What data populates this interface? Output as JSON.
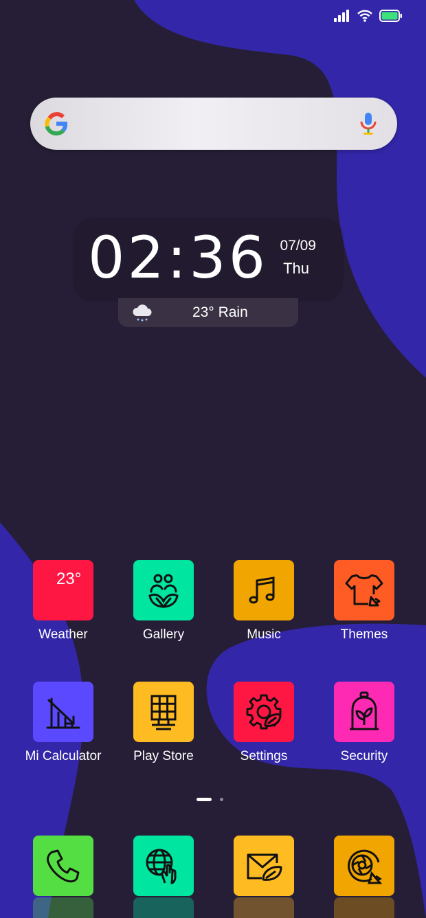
{
  "status_bar": {
    "icons": [
      "signal-icon",
      "wifi-icon",
      "battery-icon"
    ]
  },
  "search": {
    "icons": [
      "google-logo-icon",
      "mic-icon"
    ]
  },
  "clock": {
    "time": "02:36",
    "date": "07/09",
    "day": "Thu"
  },
  "weather": {
    "text": "23° Rain",
    "icon": "rain-cloud-icon"
  },
  "apps": [
    {
      "label": "Weather",
      "tile_text": "23°",
      "color": "#ff1744",
      "icon": "weather-icon"
    },
    {
      "label": "Gallery",
      "color": "#00e5a0",
      "icon": "gallery-icon"
    },
    {
      "label": "Music",
      "color": "#f0a500",
      "icon": "music-note-icon"
    },
    {
      "label": "Themes",
      "color": "#ff5c25",
      "icon": "tshirt-icon"
    },
    {
      "label": "Mi Calculator",
      "color": "#5a49ff",
      "icon": "chart-down-icon"
    },
    {
      "label": "Play Store",
      "color": "#ffbb22",
      "icon": "store-grid-icon"
    },
    {
      "label": "Settings",
      "color": "#ff1744",
      "icon": "gear-leaf-icon"
    },
    {
      "label": "Security",
      "color": "#ff2ab4",
      "icon": "plant-jar-icon"
    }
  ],
  "page_indicator": {
    "pages": 2,
    "current": 1
  },
  "dock": [
    {
      "color": "#55dd44",
      "icon": "phone-icon"
    },
    {
      "color": "#00e5a0",
      "icon": "globe-hand-icon"
    },
    {
      "color": "#ffbb22",
      "icon": "mail-leaf-icon"
    },
    {
      "color": "#f0a500",
      "icon": "camera-lens-icon"
    }
  ]
}
